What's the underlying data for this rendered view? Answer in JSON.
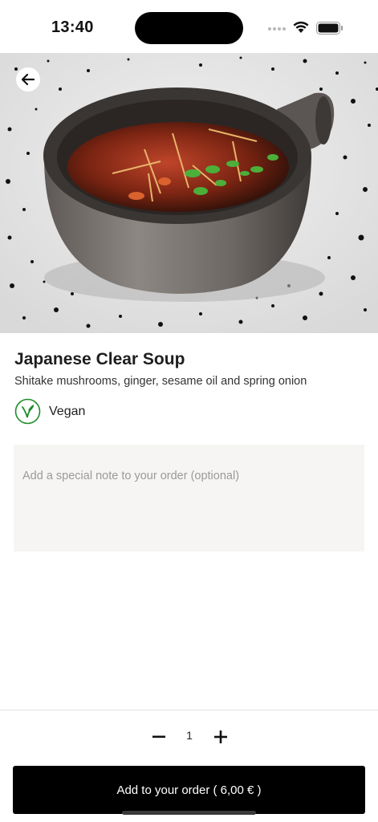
{
  "status_bar": {
    "time": "13:40",
    "icons": [
      "signal-icon",
      "wifi-icon",
      "battery-icon"
    ]
  },
  "header": {
    "back_icon": "arrow-left-icon"
  },
  "hero": {
    "subject": "soup bowl photo"
  },
  "dish": {
    "title": "Japanese Clear Soup",
    "description": "Shitake mushrooms, ginger, sesame oil and spring onion",
    "diet": {
      "icon": "vegan-leaf-icon",
      "label": "Vegan",
      "color": "#1e8c2a"
    }
  },
  "note": {
    "placeholder": "Add a special note to your order (optional)",
    "value": ""
  },
  "quantity": {
    "value": "1",
    "minus_icon": "minus-icon",
    "plus_icon": "plus-icon"
  },
  "cta": {
    "label": "Add to your order ( 6,00 € )"
  },
  "colors": {
    "primary_button": "#000000",
    "note_background": "#f6f5f3",
    "text": "#1e1e1e"
  }
}
